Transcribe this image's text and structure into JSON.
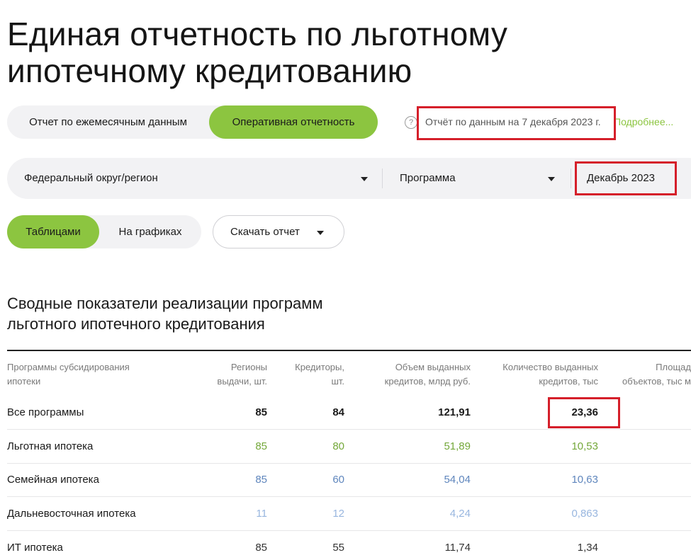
{
  "page": {
    "title_line1": "Единая отчетность по льготному",
    "title_line2": "ипотечному кредитованию"
  },
  "report_tabs": [
    "Отчет по ежемесячным данным",
    "Оперативная отчетность"
  ],
  "report_tabs_active": 1,
  "report_info": {
    "help_glyph": "?",
    "date_text": "Отчёт по данным на 7 декабря 2023 г.",
    "more_link": "Подробнее..."
  },
  "filters": {
    "region": "Федеральный округ/регион",
    "program": "Программа",
    "period": "Декабрь 2023"
  },
  "view_tabs": [
    "Таблицами",
    "На графиках"
  ],
  "view_tabs_active": 0,
  "download_label": "Скачать отчет",
  "section_title_line1": "Сводные показатели реализации программ",
  "section_title_line2": "льготного ипотечного кредитования",
  "table": {
    "headers": [
      [
        "Программы субсидирования",
        "ипотеки"
      ],
      [
        "Регионы",
        "выдачи, шт."
      ],
      [
        "Кредиторы,",
        "шт."
      ],
      [
        "Объем выданных",
        "кредитов, млрд руб."
      ],
      [
        "Количество выданных",
        "кредитов, тыс"
      ],
      [
        "Площад",
        "объектов, тыс м"
      ]
    ],
    "rows": [
      {
        "name": "Все программы",
        "regions": "85",
        "creditors": "84",
        "volume": "121,91",
        "count": "23,36"
      },
      {
        "name": "Льготная ипотека",
        "regions": "85",
        "creditors": "80",
        "volume": "51,89",
        "count": "10,53"
      },
      {
        "name": "Семейная ипотека",
        "regions": "85",
        "creditors": "60",
        "volume": "54,04",
        "count": "10,63"
      },
      {
        "name": "Дальневосточная ипотека",
        "regions": "11",
        "creditors": "12",
        "volume": "4,24",
        "count": "0,863"
      },
      {
        "name": "ИТ ипотека",
        "regions": "85",
        "creditors": "55",
        "volume": "11,74",
        "count": "1,34"
      }
    ]
  },
  "colors": {
    "accent_green": "#8cc540",
    "highlight_red": "#d51f2a",
    "row_all": "#1a1a1a",
    "row_preferential": "#74a83a",
    "row_family": "#5f86bd",
    "row_fareast": "#98b6df",
    "row_it": "#333333"
  }
}
